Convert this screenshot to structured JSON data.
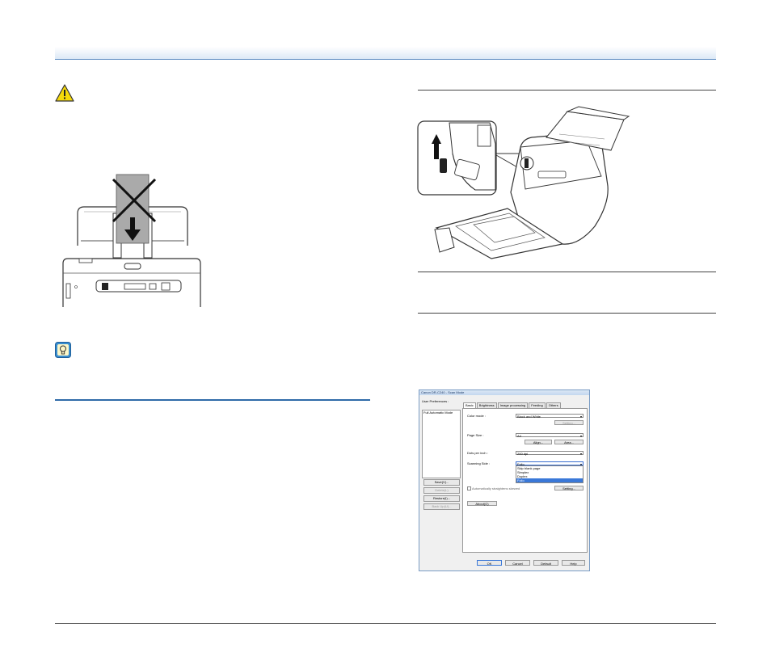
{
  "icons": {
    "warning": "warning-triangle-icon",
    "hint": "lightbulb-hint-icon"
  },
  "colors": {
    "header_rule": "#6d97c8",
    "section_rule": "#2f6aa8",
    "warning_yellow": "#f5d90a",
    "hint_blue": "#3a8ed0"
  },
  "dialog": {
    "title": "Canon DR-C240 - Scan Mode",
    "user_preferences_label": "User Preferences :",
    "preferences": [
      "Full Automatic Mode"
    ],
    "left_buttons": [
      {
        "label": "Save(V)...",
        "enabled": true
      },
      {
        "label": "Delete(L)",
        "enabled": false
      },
      {
        "label": "Restore(I)...",
        "enabled": true
      },
      {
        "label": "Back Up(U)...",
        "enabled": false
      }
    ],
    "tabs": [
      "Basic",
      "Brightness",
      "Image processing",
      "Feeding",
      "Others"
    ],
    "active_tab": "Basic",
    "color_mode_label": "Color mode :",
    "color_mode_value": "Black and White",
    "setting_button": "Setting...",
    "page_size_label": "Page Size :",
    "page_size_value": "A4",
    "align_button": "Align...",
    "area_button": "Area...",
    "dpi_label": "Dots per inch :",
    "dpi_value": "200 dpi",
    "scanning_side_label": "Scanning Side :",
    "scanning_side_value": "Folio",
    "scanning_side_options": [
      "Skip blank page",
      "Simplex",
      "Duplex",
      "Folio"
    ],
    "scanning_side_highlighted": "Folio",
    "straighten_label": "Automatically straightens skewed",
    "straighten_setting_button": "Setting...",
    "about_button": "About(O)",
    "footer_buttons": [
      "OK",
      "Cancel",
      "Default",
      "Help"
    ]
  }
}
